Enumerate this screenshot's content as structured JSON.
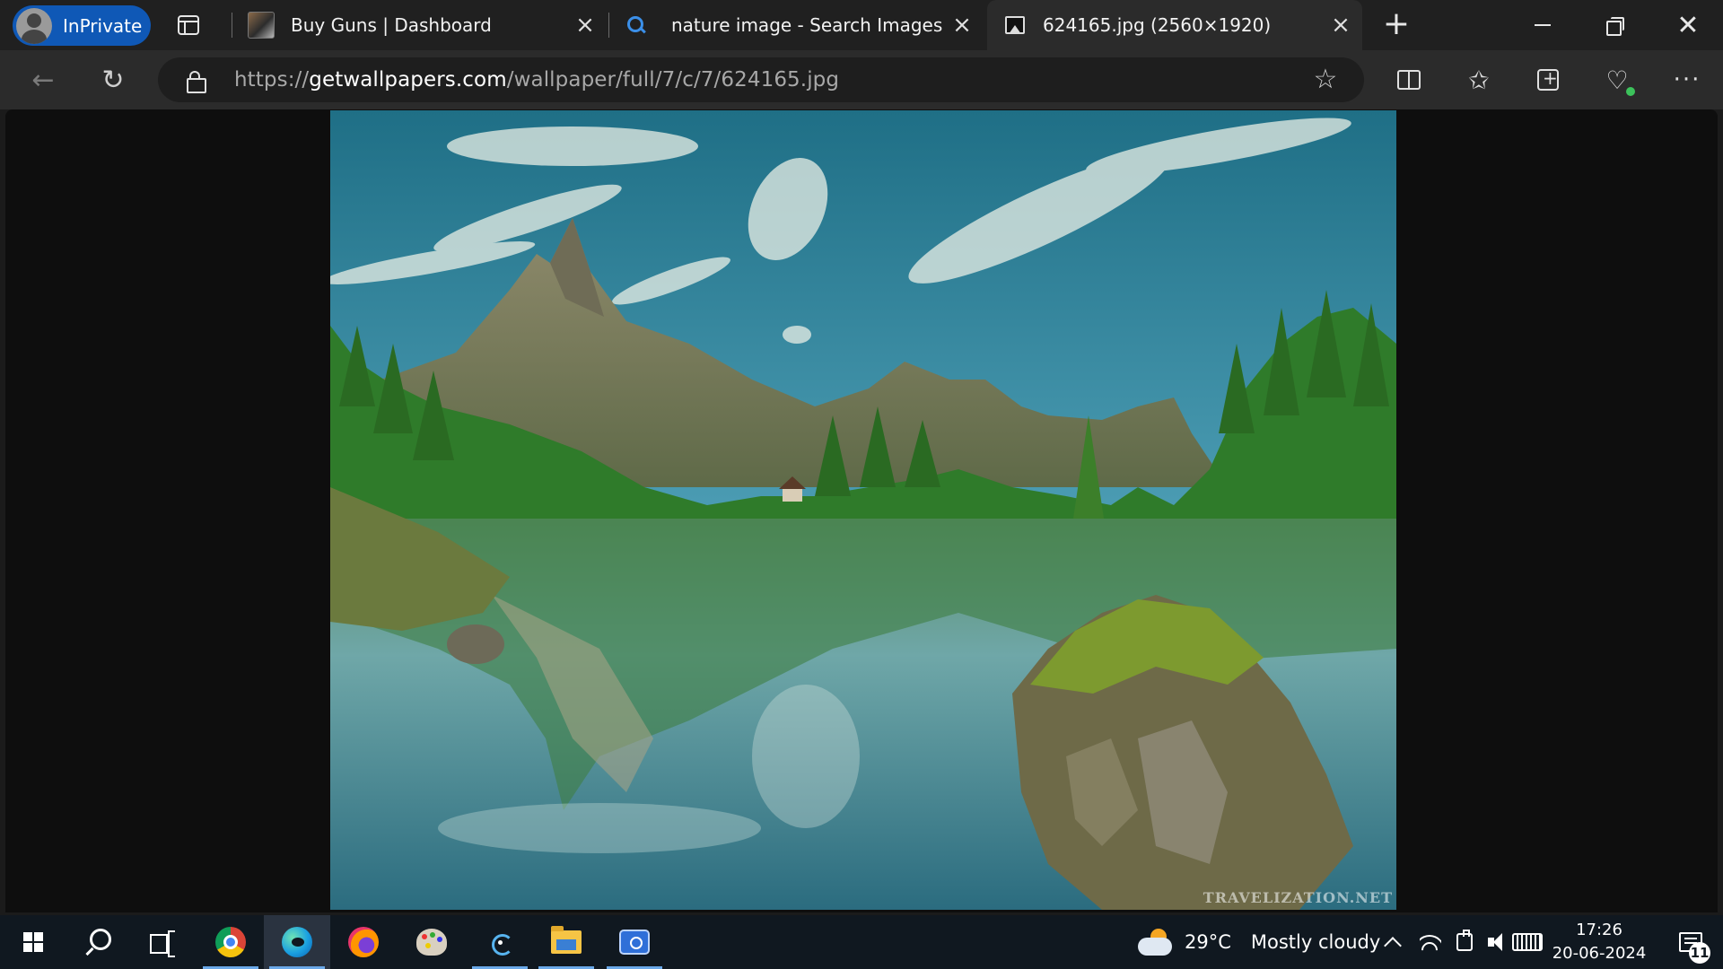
{
  "browser": {
    "profile_label": "InPrivate",
    "tabs": [
      {
        "title": "Buy Guns | Dashboard",
        "icon": "dashboard-favicon",
        "active": false
      },
      {
        "title": "nature image - Search Images",
        "icon": "search-favicon",
        "active": false
      },
      {
        "title": "624165.jpg (2560×1920)",
        "icon": "image-favicon",
        "active": true
      }
    ],
    "address": {
      "scheme": "https://",
      "host": "getwallpapers.com",
      "path": "/wallpaper/full/7/c/7/624165.jpg"
    }
  },
  "image": {
    "description_icon": "landscape-photo",
    "watermark": "TRAVELIZATION.NET"
  },
  "taskbar": {
    "apps": [
      "start",
      "search",
      "task-view",
      "chrome",
      "edge",
      "firefox",
      "paint",
      "snipping-tool",
      "file-explorer",
      "camera"
    ],
    "weather": {
      "temperature": "29°C",
      "condition": "Mostly cloudy"
    },
    "clock": {
      "time": "17:26",
      "date": "20-06-2024"
    },
    "notifications": "11"
  },
  "colors": {
    "accent": "#0f58b6",
    "tab_bar": "#202020",
    "toolbar": "#2b2b2b",
    "taskbar": "#101820"
  }
}
